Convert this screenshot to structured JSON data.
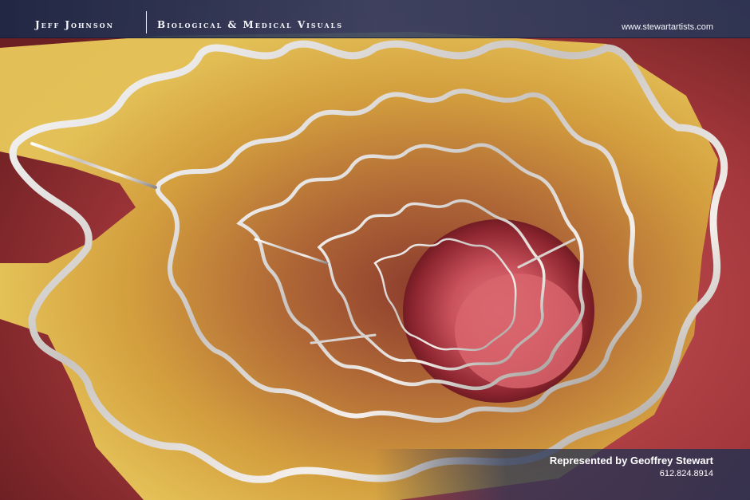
{
  "header": {
    "name": "Jeff Johnson",
    "tagline": "Biological & Medical Visuals",
    "website": "www.stewartartists.com"
  },
  "footer": {
    "represented_by": "Represented by Geoffrey Stewart",
    "phone": "612.824.8914"
  },
  "artwork": {
    "subject": "stent-in-artery-icon",
    "colors": {
      "artery_wall": "#a83a3c",
      "plaque": "#d9a640",
      "lumen": "#c8505a",
      "stent_metal": "#dcdcdc",
      "header_bar": "#2c3a5e"
    }
  }
}
